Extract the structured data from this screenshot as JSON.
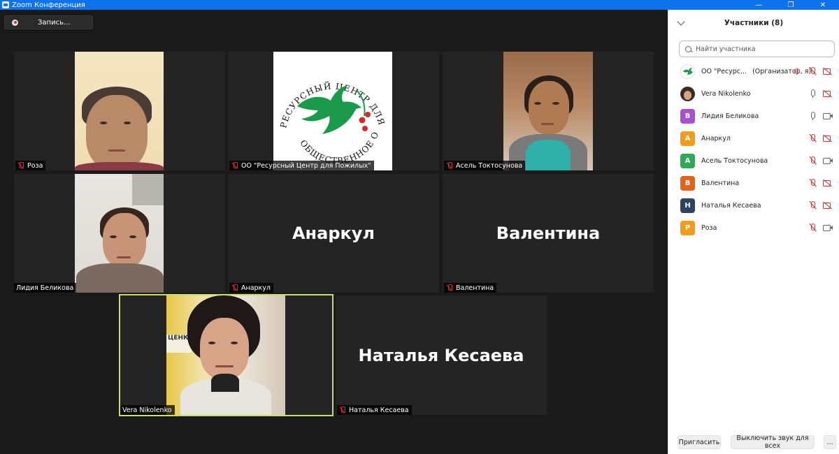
{
  "window": {
    "title": "Zoom Конференция"
  },
  "recording": {
    "label": "Запись..."
  },
  "tiles": [
    {
      "name": "Роза",
      "muted": true,
      "type": "video"
    },
    {
      "name": "ОО \"Ресурсный Центр для Пожилых\"",
      "muted": true,
      "type": "logo"
    },
    {
      "name": "Асель Токтосунова",
      "muted": true,
      "type": "video"
    },
    {
      "name": "Лидия Беликова",
      "muted": false,
      "type": "video"
    },
    {
      "name": "Анаркул",
      "muted": true,
      "type": "name-only",
      "display": "Анаркул"
    },
    {
      "name": "Валентина",
      "muted": true,
      "type": "name-only",
      "display": "Валентина"
    },
    {
      "name": "Vera Nikolenko",
      "muted": false,
      "type": "video",
      "active_speaker": true
    },
    {
      "name": "Наталья Кесаева",
      "muted": true,
      "type": "name-only",
      "display": "Наталья Кесаева"
    }
  ],
  "logo": {
    "top_text": "РЕСУРСНЫЙ ЦЕНТР ДЛЯ ПОЖИЛЫХ",
    "bottom_text": "ОБЩЕСТВЕННОЕ ОБЪЕДИНЕНИЕ",
    "bird_color": "#1a9a4a",
    "berry_color": "#d42a2a"
  },
  "sidebar": {
    "title": "Участники (8)",
    "search_placeholder": "Найти участника",
    "participants": [
      {
        "name": "ОО \"Ресурс...",
        "role": "(Организатор, я)",
        "avatar": "logo",
        "mic": "off",
        "cam": "off",
        "recording": true
      },
      {
        "name": "Vera Nikolenko",
        "role": "",
        "avatar": "photo",
        "mic": "on",
        "cam": "off"
      },
      {
        "name": "Лидия Беликова",
        "role": "",
        "initial": "В",
        "color": "#a94fd1",
        "mic": "on",
        "cam": "on"
      },
      {
        "name": "Анаркул",
        "role": "",
        "initial": "А",
        "color": "#f29d1a",
        "mic": "off",
        "cam": "off"
      },
      {
        "name": "Асель Токтосунова",
        "role": "",
        "initial": "А",
        "color": "#2eaa55",
        "mic": "off",
        "cam": "on"
      },
      {
        "name": "Валентина",
        "role": "",
        "initial": "В",
        "color": "#e0641b",
        "mic": "off",
        "cam": "off"
      },
      {
        "name": "Наталья Кесаева",
        "role": "",
        "initial": "Н",
        "color": "#2c4463",
        "mic": "off",
        "cam": "off"
      },
      {
        "name": "Роза",
        "role": "",
        "initial": "Р",
        "color": "#f29d1a",
        "mic": "off",
        "cam": "on"
      }
    ],
    "footer": {
      "invite": "Пригласить",
      "mute_all": "Выключить звук для всех",
      "more": "..."
    }
  }
}
